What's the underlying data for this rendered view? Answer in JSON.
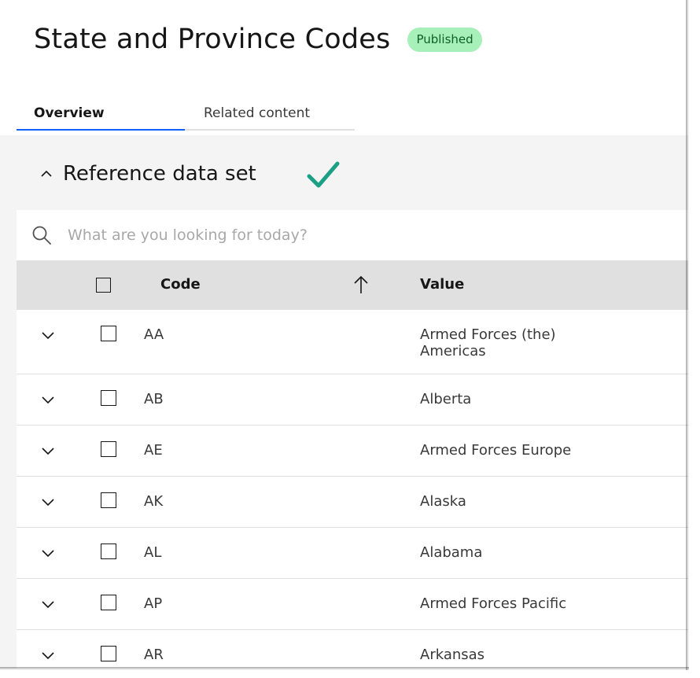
{
  "page": {
    "title": "State and Province Codes",
    "status_badge": "Published"
  },
  "tabs": [
    {
      "label": "Overview",
      "active": true
    },
    {
      "label": "Related content",
      "active": false
    }
  ],
  "section": {
    "title": "Reference data set",
    "status_icon": "checkmark-icon",
    "status_color": "#1ba086"
  },
  "search": {
    "placeholder": "What are you looking for today?"
  },
  "table": {
    "columns": {
      "code": "Code",
      "value": "Value"
    },
    "sort": "ascending",
    "rows": [
      {
        "code": "AA",
        "value": "Armed Forces (the) Americas"
      },
      {
        "code": "AB",
        "value": "Alberta"
      },
      {
        "code": "AE",
        "value": "Armed Forces Europe"
      },
      {
        "code": "AK",
        "value": "Alaska"
      },
      {
        "code": "AL",
        "value": "Alabama"
      },
      {
        "code": "AP",
        "value": "Armed Forces Pacific"
      },
      {
        "code": "AR",
        "value": "Arkansas"
      }
    ]
  },
  "colors": {
    "accent": "#0f62fe",
    "badge_bg": "#a7f0ba",
    "badge_text": "#0e6027",
    "header_bg": "#e0e0e0",
    "panel_bg": "#f4f4f4"
  }
}
